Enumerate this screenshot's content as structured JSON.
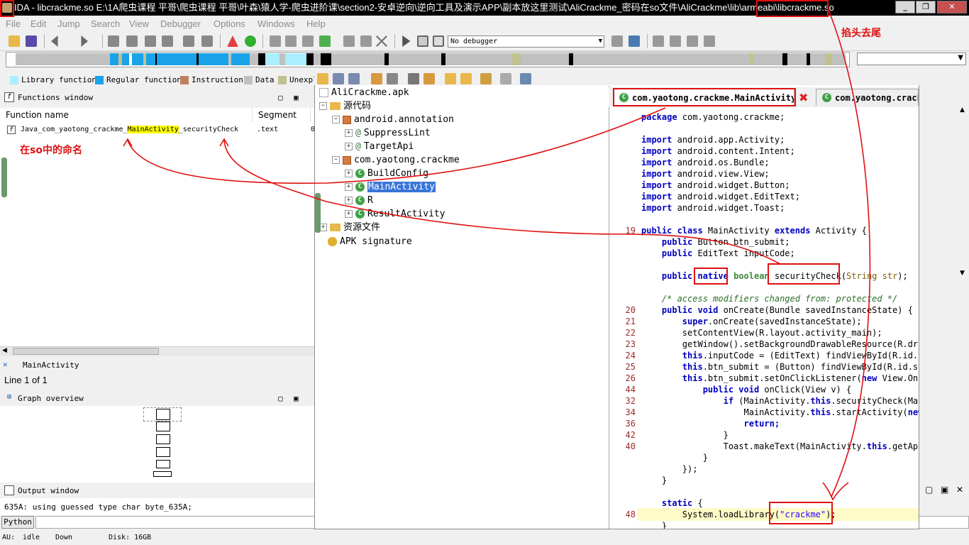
{
  "window": {
    "title": "IDA - libcrackme.so E:\\1A爬虫课程 平哥\\爬虫课程 平哥\\叶森\\猿人学-爬虫进阶课\\section2-安卓逆向\\逆向工具及演示APP\\副本放这里测试\\AliCrackme_密码在so文件\\AliCrackme\\lib\\armeabi\\libcrackme.so",
    "controls": [
      "_",
      "❐",
      "✕"
    ]
  },
  "menu": [
    "File",
    "Edit",
    "Jump",
    "Search",
    "View",
    "Debugger",
    "Options",
    "Windows",
    "Help"
  ],
  "toolbar": {
    "debugger": "No debugger"
  },
  "legend": [
    {
      "label": "Library function",
      "color": "#aaeeff"
    },
    {
      "label": "Regular function",
      "color": "#1aa3e8"
    },
    {
      "label": "Instruction",
      "color": "#c08060"
    },
    {
      "label": "Data",
      "color": "#c0c0c0"
    },
    {
      "label": "Unexplored",
      "color": "#c0c090"
    }
  ],
  "functions": {
    "title": "Functions window",
    "columns": [
      "Function name",
      "Segment",
      "S"
    ],
    "row": {
      "pre": "Java_com_yaotong_crackme_",
      "hl": "MainActivity",
      "post": "_securityCheck",
      "segment": ".text",
      "extra": "0"
    }
  },
  "name_tab": "MainActivity",
  "line_info": "Line 1 of 1",
  "graph_title": "Graph overview",
  "output": {
    "title": "Output window",
    "text": "635A: using guessed type char byte_635A;",
    "button": "Python"
  },
  "status": {
    "au": "AU:",
    "au_state": "idle",
    "dir": "Down",
    "disk": "Disk: 16GB"
  },
  "tree": {
    "root": "AliCrackme.apk",
    "source": "源代码",
    "pkg1": "android.annotation",
    "pkg1_items": [
      "SuppressLint",
      "TargetApi"
    ],
    "pkg2": "com.yaotong.crackme",
    "pkg2_items": [
      "BuildConfig",
      "MainActivity",
      "R",
      "ResultActivity"
    ],
    "resources": "资源文件",
    "signature": "APK signature"
  },
  "tabs": [
    "com.yaotong.crackme.MainActivity",
    "com.yaotong.crack"
  ],
  "annotations": {
    "so_naming": "在so中的命名",
    "strip": "掐头去尾"
  },
  "code": {
    "package": "com.yaotong.crackme;",
    "imports": [
      "android.app.Activity;",
      "android.content.Intent;",
      "android.os.Bundle;",
      "android.view.View;",
      "android.widget.Button;",
      "android.widget.EditText;",
      "android.widget.Toast;"
    ],
    "lines": {
      "l19": "19",
      "l20": "20",
      "l21": "21",
      "l22": "22",
      "l23": "23",
      "l24": "24",
      "l25": "25",
      "l26": "26",
      "l44": "44",
      "l32": "32",
      "l34": "34",
      "l36": "36",
      "l42": "42",
      "l40": "40",
      "l48": "48"
    },
    "class_decl_name": "MainActivity",
    "class_decl_super": "Activity",
    "field1": "Button btn_submit;",
    "field2": "EditText inputCode;",
    "native_kw": "native",
    "bool_kw": "boolean",
    "method": "securityCheck",
    "method_args": "String str",
    "comment": "/* access modifiers changed from: protected */",
    "oncreate": "onCreate(Bundle savedInstanceState) {",
    "super_call": ".onCreate(savedInstanceState);",
    "setcontent": "setContentView(R.layout.activity_main);",
    "getwindow": "getWindow().setBackgroundDrawableResource(R.draw",
    "inputcode": ".inputCode = (EditText) findViewById(R.id.in",
    "btnsubmit": ".btn_submit = (Button) findViewById(R.id.sub",
    "listener": ".btn_submit.setOnClickListener(",
    "listener_tail": " View.OnCl",
    "onclick": "onClick(View v) {",
    "ifcheck_a": " (MainActivity.",
    "ifcheck_b": ".securityCheck(Main",
    "start_a": "MainActivity.",
    "start_b": ".startActivity(",
    "return": "return;",
    "toast_a": "Toast.makeText(MainActivity.",
    "toast_b": ".getAppl",
    "close1": "}",
    "close2": "}",
    "close3": "});",
    "close4": "}",
    "static_kw": "static",
    "system": "System.",
    "loadlib": "loadLibrary",
    "libname": "\"crackme\"",
    "close5": "}"
  }
}
